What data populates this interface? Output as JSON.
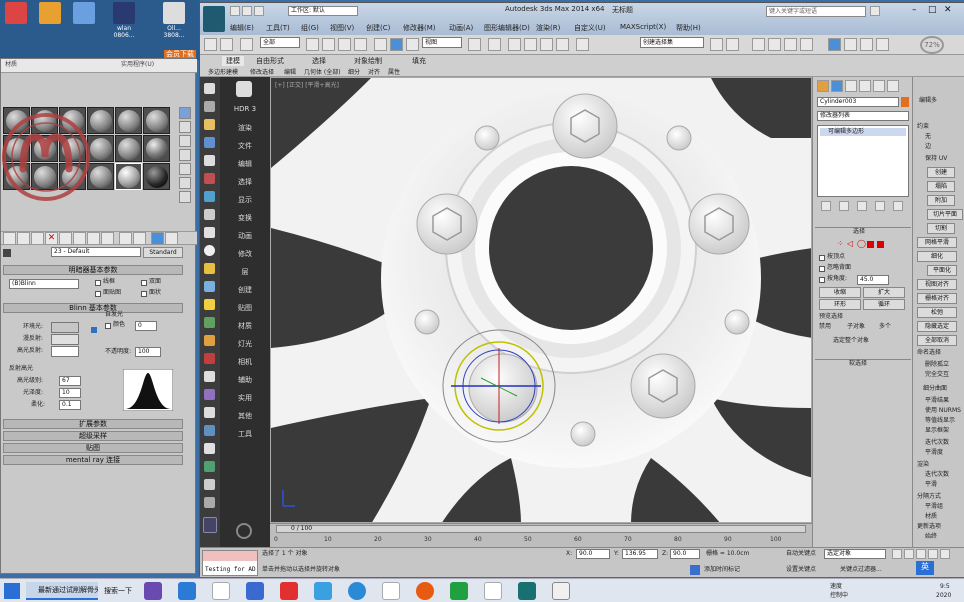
{
  "desktop": {
    "icons": [
      {
        "label": "",
        "color": "#d44"
      },
      {
        "label": "",
        "color": "#e8a030"
      },
      {
        "label": "wlan 0806...",
        "color": "#5a8fd0"
      },
      {
        "label": "Oll... 3808...",
        "color": "#ddd"
      }
    ],
    "side_label": "会员下载"
  },
  "material_editor": {
    "tabs": [
      "材质",
      "",
      "",
      "",
      "实用程序(U)"
    ],
    "material_name": "23 - Default",
    "material_type": "Standard",
    "rollouts": {
      "shader_basic": "明暗器基本参数",
      "blinn_basic": "Blinn 基本参数",
      "extended": "扩展参数",
      "supersampling": "超级采样",
      "maps": "贴图",
      "mental_ray": "mental ray 连接"
    },
    "shader": "(B)Blinn",
    "checkboxes": [
      "线框",
      "双面",
      "面贴图",
      "面状"
    ],
    "labels": {
      "ambient": "环境光:",
      "diffuse": "漫反射:",
      "specular": "高光反射:",
      "self_illum": "自发光",
      "color": "颜色",
      "opacity": "不透明度:",
      "spec_highlights": "反射高光",
      "spec_level": "高光级别:",
      "glossiness": "光泽度:",
      "soften": "柔化:"
    },
    "values": {
      "self_illum": "0",
      "opacity": "100",
      "spec_level": "67",
      "glossiness": "10",
      "soften": "0.1"
    }
  },
  "max_window": {
    "title": "Autodesk 3ds Max  2014 x64",
    "workspace": "工作区: 默认",
    "file": "无标题",
    "search_placeholder": "键入关键字或短语",
    "menus": [
      "编辑(E)",
      "工具(T)",
      "组(G)",
      "视图(V)",
      "创建(C)",
      "修改器(M)",
      "动画(A)",
      "图形编辑器(D)",
      "渲染(R)",
      "自定义(U)",
      "MAXScript(X)",
      "帮助(H)"
    ],
    "toolbar": {
      "selection_filter": "全部",
      "view_dropdown": "视图",
      "named_sel": "创建选择集",
      "percent": "72%"
    },
    "ribbon_tabs": [
      "建模",
      "自由形式",
      "选择",
      "对象绘制",
      "填充"
    ],
    "ribbon_subtabs": [
      "多边形建模",
      "修改选择",
      "编辑",
      "几何体 (全部)",
      "细分",
      "对齐",
      "属性"
    ],
    "command_column": [
      "HDR 3",
      "渲染",
      "文件",
      "编辑",
      "选择",
      "显示",
      "变换",
      "动画",
      "修改",
      "层",
      "创建",
      "贴图",
      "材质",
      "灯光",
      "相机",
      "辅助",
      "实用",
      "其他",
      "工具"
    ],
    "viewport_label": "[+] [正交] [平滑+高光]",
    "timeline": {
      "frame": "0 / 100",
      "ticks": [
        "0",
        "10",
        "20",
        "30",
        "40",
        "50",
        "60",
        "70",
        "80",
        "90",
        "100"
      ]
    },
    "status": {
      "selected": "选择了 1 个 对象",
      "prompt": "单击并拖动以选择并旋转对象",
      "x_label": "X:",
      "x": "90.0",
      "y_label": "Y:",
      "y": "136.95",
      "z_label": "Z:",
      "z": "90.0",
      "grid": "栅格 = 10.0cm",
      "auto_key": "自动关键点",
      "set_key": "设置关键点",
      "key_filter": "关键点过滤器...",
      "sel_set": "选定对象",
      "add_tag": "添加时间标记",
      "listener": "Testing for AD"
    }
  },
  "command_panel": {
    "object_name": "Cylinder003",
    "modifier_list": "修改器列表",
    "stack_item": "可编辑多边形",
    "selection": "选择",
    "by_vertex": "按顶点",
    "ignore_back": "忽略背面",
    "by_angle": "按角度:",
    "angle": "45.0",
    "shrink": "收缩",
    "grow": "扩大",
    "ring": "环形",
    "loop": "循环",
    "preview": "预览选择",
    "disable": "禁用",
    "sub_obj": "子对象",
    "multi": "多个",
    "selected_count": "选定整个对象",
    "soft_sel": "软选择"
  },
  "command_panel2": {
    "header": "编辑多",
    "labels": [
      "约束",
      "无",
      "边",
      "保持 UV",
      "创建",
      "塌陷",
      "附加",
      "切片平面",
      "切割",
      "网格平滑",
      "细化",
      "平面化",
      "视图对齐",
      "栅格对齐",
      "松弛",
      "隐藏选定",
      "全部取消",
      "命名选择",
      "删除孤立",
      "完全交互",
      "细分曲面",
      "平滑结果",
      "使用 NURMS",
      "等值线显示",
      "显示框架",
      "迭代次数",
      "平滑度",
      "渲染",
      "迭代次数",
      "平滑",
      "分隔方式",
      "平滑组",
      "材质",
      "更新选项",
      "始终",
      "渲染时",
      "手动"
    ]
  },
  "taskbar": {
    "task_label": "最新通过试削解骨头",
    "search": "搜索一下",
    "ime": "英",
    "time": "9:5",
    "date": "2020",
    "tray": [
      "速度",
      "控制中"
    ]
  }
}
